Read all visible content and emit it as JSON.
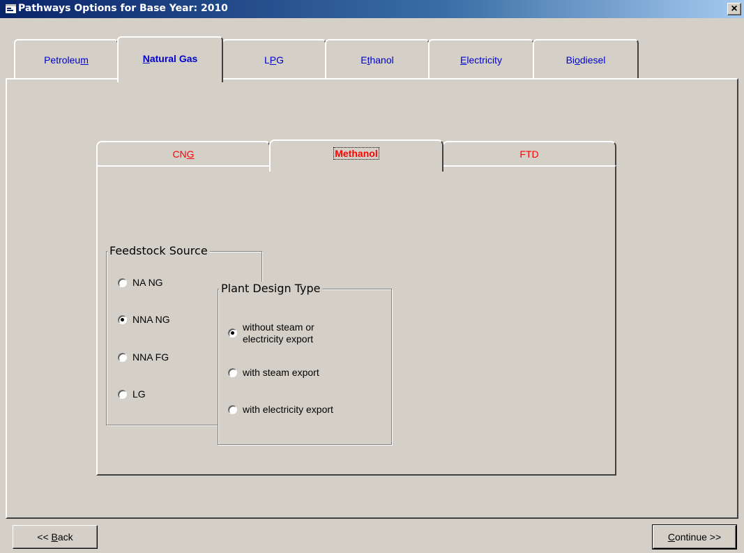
{
  "window": {
    "title": "Pathways Options for Base Year: 2010",
    "close_glyph": "×",
    "icon": "app-window-icon"
  },
  "outer_tabs": [
    {
      "label_pre": "Petroleu",
      "label_u": "m",
      "label_post": "",
      "active": false
    },
    {
      "label_pre": "",
      "label_u": "N",
      "label_post": "atural Gas",
      "active": true
    },
    {
      "label_pre": "L",
      "label_u": "P",
      "label_post": "G",
      "active": false
    },
    {
      "label_pre": "E",
      "label_u": "t",
      "label_post": "hanol",
      "active": false
    },
    {
      "label_pre": "",
      "label_u": "E",
      "label_post": "lectricity",
      "active": false
    },
    {
      "label_pre": "Bi",
      "label_u": "o",
      "label_post": "diesel",
      "active": false
    }
  ],
  "inner_tabs": [
    {
      "label_pre": "CN",
      "label_u": "G",
      "label_post": "",
      "active": false
    },
    {
      "label_pre": "Methanol",
      "label_u": "",
      "label_post": "",
      "active": true
    },
    {
      "label_pre": "FTD",
      "label_u": "",
      "label_post": "",
      "active": false
    }
  ],
  "feedstock": {
    "title": "Feedstock Source",
    "options": [
      {
        "label": "NA NG",
        "selected": false
      },
      {
        "label": "NNA NG",
        "selected": true
      },
      {
        "label": "NNA FG",
        "selected": false
      },
      {
        "label": "LG",
        "selected": false
      }
    ]
  },
  "plant_design": {
    "title": "Plant Design Type",
    "options": [
      {
        "line1": "without steam or",
        "line2": "electricity export",
        "selected": true
      },
      {
        "line1": "with steam export",
        "line2": "",
        "selected": false
      },
      {
        "line1": "with electricity export",
        "line2": "",
        "selected": false
      }
    ]
  },
  "buttons": {
    "back_pre": "<< ",
    "back_u": "B",
    "back_post": "ack",
    "continue_u": "C",
    "continue_post": "ontinue >>"
  }
}
